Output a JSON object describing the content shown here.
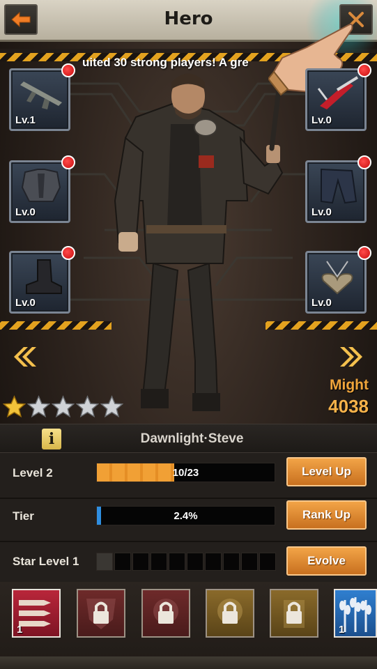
{
  "header": {
    "title": "Hero",
    "back_icon": "arrow-left-icon",
    "close_icon": "close-icon"
  },
  "marquee": {
    "text": "uited 30 strong players! A gre"
  },
  "equipment": {
    "left": [
      {
        "name": "rifle",
        "level": "Lv.1"
      },
      {
        "name": "armor",
        "level": "Lv.0"
      },
      {
        "name": "boots",
        "level": "Lv.0"
      }
    ],
    "right": [
      {
        "name": "multitool",
        "level": "Lv.0"
      },
      {
        "name": "pants",
        "level": "Lv.0"
      },
      {
        "name": "pendant",
        "level": "Lv.0"
      }
    ]
  },
  "hero": {
    "name": "Dawnlight·Steve",
    "might_label": "Might",
    "might_value": "4038",
    "stars_filled": 1,
    "stars_total": 5
  },
  "stats": {
    "level_label": "Level 2",
    "level_progress_text": "10/23",
    "level_progress_fraction": 0.435,
    "level_button": "Level Up",
    "tier_label": "Tier",
    "tier_progress_text": "2.4%",
    "tier_progress_fraction": 0.024,
    "tier_button": "Rank Up",
    "star_level_label": "Star Level 1",
    "star_cells_filled": 1,
    "star_cells_total": 10,
    "evolve_button": "Evolve"
  },
  "skills": [
    {
      "name": "bullets-skill",
      "count": "1",
      "locked": false
    },
    {
      "name": "shield-skill",
      "count": "",
      "locked": true
    },
    {
      "name": "burst-skill",
      "count": "",
      "locked": true
    },
    {
      "name": "gear-skill",
      "count": "",
      "locked": true
    },
    {
      "name": "wheat-skill",
      "count": "",
      "locked": true
    },
    {
      "name": "harvest-skill",
      "count": "1",
      "locked": false
    }
  ],
  "colors": {
    "accent": "#f1a035",
    "might": "#f6b24a",
    "notify": "#d81b1b",
    "tier_fill": "#2f8ee0"
  }
}
